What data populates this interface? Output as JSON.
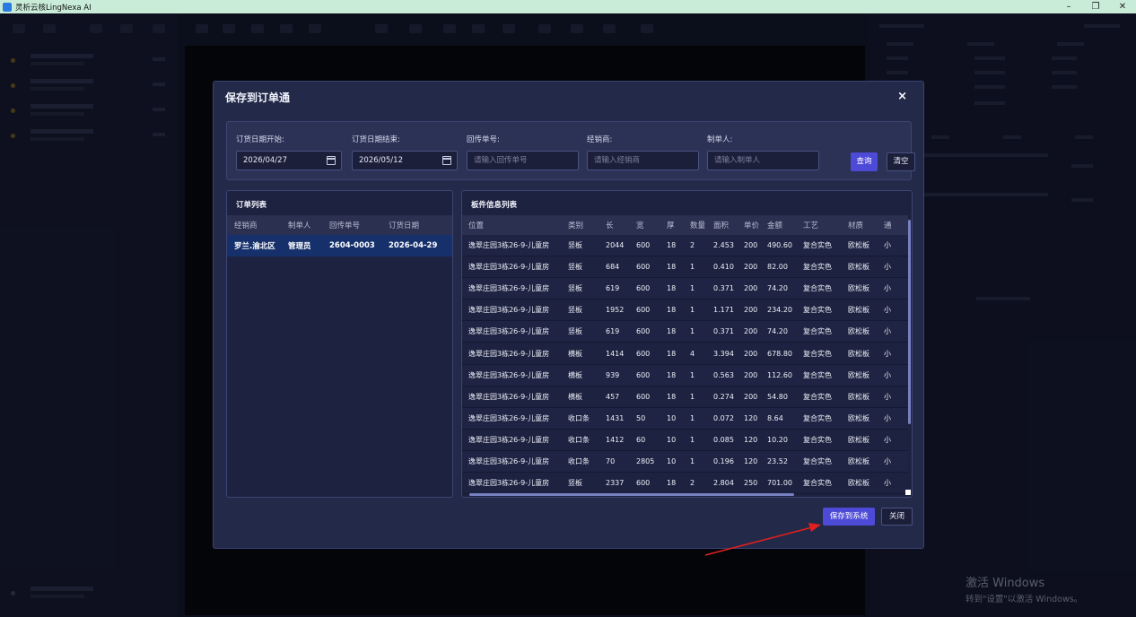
{
  "window": {
    "title": "灵析云核LingNexa AI",
    "minimize": "–",
    "maximize": "❐",
    "close": "✕"
  },
  "watermark": {
    "line1": "激活 Windows",
    "line2": "转到\"设置\"以激活 Windows。"
  },
  "dialog": {
    "title": "保存到订单通",
    "close": "×",
    "filters": {
      "date_start_label": "订货日期开始:",
      "date_start_value": "2026/04/27",
      "date_end_label": "订货日期结束:",
      "date_end_value": "2026/05/12",
      "return_no_label": "回传单号:",
      "return_no_placeholder": "请输入回传单号",
      "dealer_label": "经销商:",
      "dealer_placeholder": "请输入经销商",
      "maker_label": "制单人:",
      "maker_placeholder": "请输入制单人",
      "query_button": "查询",
      "clear_button": "清空"
    },
    "order_list": {
      "title": "订单列表",
      "columns": [
        "经销商",
        "制单人",
        "回传单号",
        "订货日期"
      ],
      "rows": [
        [
          "罗兰.渝北区",
          "管理员",
          "2604-0003",
          "2026-04-29"
        ]
      ]
    },
    "panel_list": {
      "title": "板件信息列表",
      "columns": [
        "位置",
        "类别",
        "长",
        "宽",
        "厚",
        "数量",
        "面积",
        "单价",
        "金额",
        "工艺",
        "材质",
        "通"
      ],
      "rows": [
        [
          "逸翠庄园3栋26-9-儿童房",
          "竖板",
          "2044",
          "600",
          "18",
          "2",
          "2.453",
          "200",
          "490.60",
          "复合实色",
          "欧松板",
          "小"
        ],
        [
          "逸翠庄园3栋26-9-儿童房",
          "竖板",
          "684",
          "600",
          "18",
          "1",
          "0.410",
          "200",
          "82.00",
          "复合实色",
          "欧松板",
          "小"
        ],
        [
          "逸翠庄园3栋26-9-儿童房",
          "竖板",
          "619",
          "600",
          "18",
          "1",
          "0.371",
          "200",
          "74.20",
          "复合实色",
          "欧松板",
          "小"
        ],
        [
          "逸翠庄园3栋26-9-儿童房",
          "竖板",
          "1952",
          "600",
          "18",
          "1",
          "1.171",
          "200",
          "234.20",
          "复合实色",
          "欧松板",
          "小"
        ],
        [
          "逸翠庄园3栋26-9-儿童房",
          "竖板",
          "619",
          "600",
          "18",
          "1",
          "0.371",
          "200",
          "74.20",
          "复合实色",
          "欧松板",
          "小"
        ],
        [
          "逸翠庄园3栋26-9-儿童房",
          "横板",
          "1414",
          "600",
          "18",
          "4",
          "3.394",
          "200",
          "678.80",
          "复合实色",
          "欧松板",
          "小"
        ],
        [
          "逸翠庄园3栋26-9-儿童房",
          "横板",
          "939",
          "600",
          "18",
          "1",
          "0.563",
          "200",
          "112.60",
          "复合实色",
          "欧松板",
          "小"
        ],
        [
          "逸翠庄园3栋26-9-儿童房",
          "横板",
          "457",
          "600",
          "18",
          "1",
          "0.274",
          "200",
          "54.80",
          "复合实色",
          "欧松板",
          "小"
        ],
        [
          "逸翠庄园3栋26-9-儿童房",
          "收口条",
          "1431",
          "50",
          "10",
          "1",
          "0.072",
          "120",
          "8.64",
          "复合实色",
          "欧松板",
          "小"
        ],
        [
          "逸翠庄园3栋26-9-儿童房",
          "收口条",
          "1412",
          "60",
          "10",
          "1",
          "0.085",
          "120",
          "10.20",
          "复合实色",
          "欧松板",
          "小"
        ],
        [
          "逸翠庄园3栋26-9-儿童房",
          "收口条",
          "70",
          "2805",
          "10",
          "1",
          "0.196",
          "120",
          "23.52",
          "复合实色",
          "欧松板",
          "小"
        ],
        [
          "逸翠庄园3栋26-9-儿童房",
          "竖板",
          "2337",
          "600",
          "18",
          "2",
          "2.804",
          "250",
          "701.00",
          "复合实色",
          "欧松板",
          "小"
        ]
      ]
    },
    "save_button": "保存到系统",
    "close_button": "关闭"
  },
  "colors": {
    "accent": "#4e4ad8",
    "selected_row": "#16306b",
    "annotation_arrow": "#e02020"
  }
}
